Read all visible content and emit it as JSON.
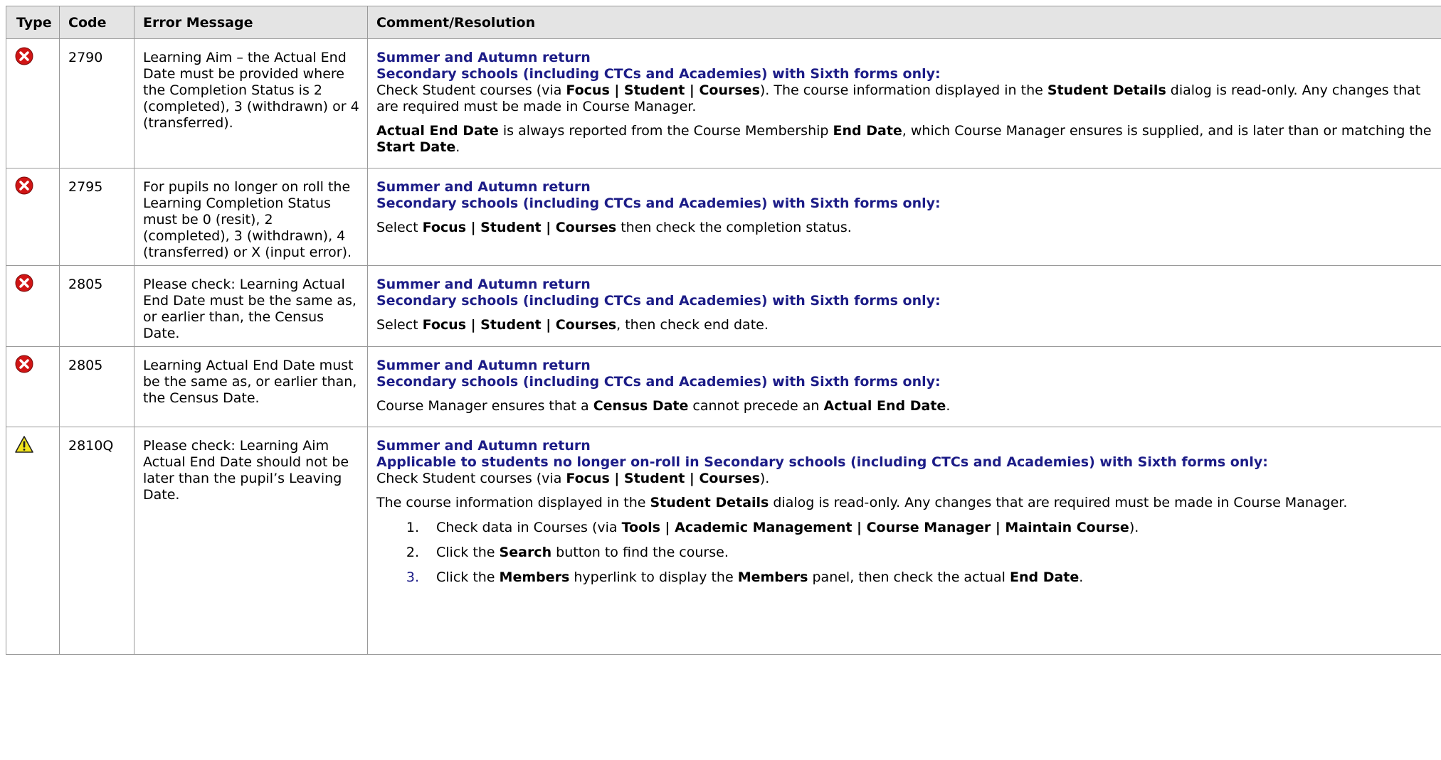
{
  "headers": {
    "type": "Type",
    "code": "Code",
    "message": "Error Message",
    "comment": "Comment/Resolution"
  },
  "colors": {
    "heading": "#1c1c87",
    "error": "#d01515",
    "warning": "#f3e51a",
    "header_bg": "#e4e4e4",
    "border": "#999999"
  },
  "rows": [
    {
      "type": "error-icon",
      "code": "2790",
      "message": "Learning Aim – the Actual End Date must be provided where the Completion Status is 2 (completed), 3 (withdrawn) or 4 (transferred).",
      "heading1": "Summer and Autumn return",
      "heading2": "Secondary schools (including CTCs and Academies) with Sixth forms only:",
      "p1": {
        "a": "Check Student courses (via ",
        "b": "Focus | Student | Courses",
        "c": "). The course information displayed in the ",
        "d": "Student Details",
        "e": " dialog is read-only. Any changes that are required must be made in Course Manager."
      },
      "p2": {
        "a": "Actual End Date",
        "b": " is always reported from the Course Membership ",
        "c": "End Date",
        "d": ", which Course Manager ensures is supplied, and is later than or matching the ",
        "e": "Start Date",
        "f": "."
      }
    },
    {
      "type": "error-icon",
      "code": "2795",
      "message": "For pupils no longer on roll the Learning Completion Status must be 0 (resit), 2 (completed), 3 (withdrawn), 4 (transferred) or X (input error).",
      "heading1": "Summer and Autumn return",
      "heading2": "Secondary schools (including CTCs and Academies) with Sixth forms only:",
      "p1": {
        "a": "Select ",
        "b": "Focus | Student | Courses",
        "c": " then check the completion status."
      }
    },
    {
      "type": "error-icon",
      "code": "2805",
      "message": "Please check: Learning Actual End Date must be the same as, or earlier than, the Census Date.",
      "heading1": "Summer and Autumn return",
      "heading2": "Secondary schools (including CTCs and Academies) with Sixth forms only:",
      "p1": {
        "a": "Select ",
        "b": "Focus | Student | Courses",
        "c": ", then check end date."
      }
    },
    {
      "type": "error-icon",
      "code": "2805",
      "message": "Learning Actual End Date must be the same as, or earlier than, the Census Date.",
      "heading1": "Summer and Autumn return",
      "heading2": "Secondary schools (including CTCs and Academies) with Sixth forms only:",
      "p1": {
        "a": "Course Manager ensures that a ",
        "b": "Census Date",
        "c": " cannot precede an ",
        "d": "Actual End Date",
        "e": "."
      }
    },
    {
      "type": "warning-icon",
      "code": "2810Q",
      "message": "Please check: Learning Aim Actual End Date should not be later than the pupil’s Leaving Date.",
      "heading1": "Summer and Autumn return",
      "heading2": "Applicable to students no longer on-roll in Secondary schools (including CTCs and Academies) with Sixth forms only:",
      "p1": {
        "a": "Check Student courses (via ",
        "b": "Focus | Student | Courses",
        "c": ")."
      },
      "p2": {
        "a": "The course information displayed in the ",
        "b": "Student Details",
        "c": " dialog is read-only. Any changes that are required must be made in Course Manager."
      },
      "steps": [
        {
          "num": "1.",
          "a": "Check data in Courses (via ",
          "b": "Tools | Academic Management | Course Manager | Maintain Course",
          "c": ")."
        },
        {
          "num": "2.",
          "a": "Click the ",
          "b": "Search",
          "c": " button to find the course."
        },
        {
          "num": "3.",
          "a": "Click the ",
          "b": "Members",
          "c": " hyperlink to display the ",
          "d": "Members",
          "e": " panel, then check the actual ",
          "f": "End Date",
          "g": "."
        }
      ]
    }
  ]
}
